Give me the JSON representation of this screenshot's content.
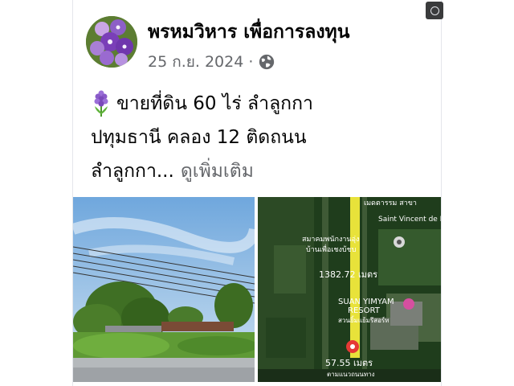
{
  "post": {
    "author": "พรหมวิหาร เพื่อการลงทุน",
    "date": "25 ก.ย. 2024",
    "separator": "·",
    "privacy_icon": "globe-icon",
    "text_line1": "ขายที่ดิน 60 ไร่ ลำลูกกา",
    "text_line2": "ปทุมธานี คลอง 12 ติดถนน",
    "text_line3": "ลำลูกกา...",
    "see_more": "ดูเพิ่มเติม",
    "emoji_icon": "hyacinth-flower-icon"
  },
  "photos": {
    "left_alt": "roadside land photo",
    "map": {
      "label_top": "เมดตารรม สาขา",
      "label_foundation": "Saint Vincent de Paul Foundation...",
      "label_assoc1": "สมาคมพนักงานอุ่ง",
      "label_assoc2": "บ้านเพื่อเชงบ้ชบ",
      "measure_1": "1382.72 เมตร",
      "resort_1": "SUAN YIMYAM",
      "resort_2": "RESORT",
      "resort_3": "สวนยิ้มแย้มรีสอร์ท",
      "measure_2": "57.55 เมตร",
      "label_bottom": "ตามแนวถนนทาง"
    }
  },
  "colors": {
    "text_primary": "#050505",
    "text_secondary": "#65676b",
    "map_line": "#e8e23a",
    "map_marker": "#e53935"
  }
}
